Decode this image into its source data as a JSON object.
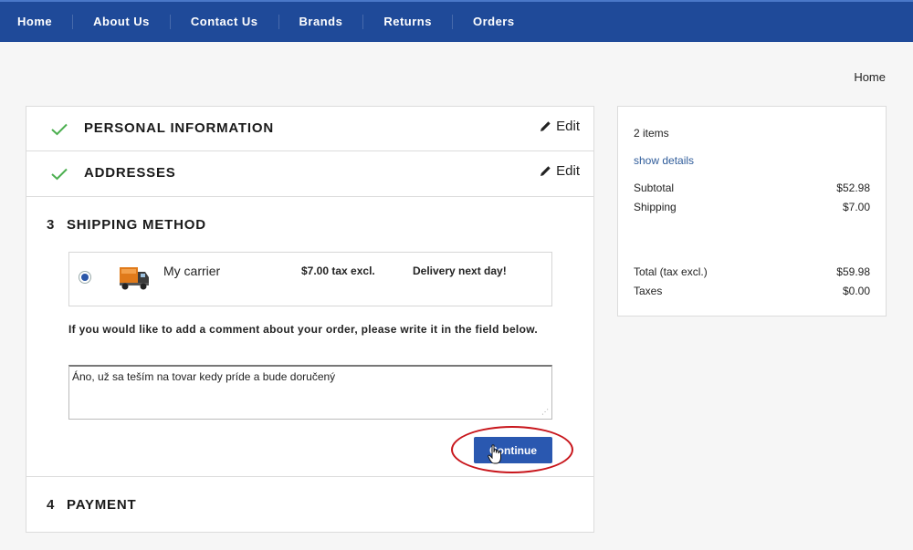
{
  "nav": {
    "items": [
      {
        "label": "Home"
      },
      {
        "label": "About Us"
      },
      {
        "label": "Contact Us"
      },
      {
        "label": "Brands"
      },
      {
        "label": "Returns"
      },
      {
        "label": "Orders"
      }
    ]
  },
  "breadcrumb": "Home",
  "steps": {
    "personal": {
      "title": "PERSONAL INFORMATION",
      "edit_label": "Edit"
    },
    "addresses": {
      "title": "ADDRESSES",
      "edit_label": "Edit"
    },
    "shipping": {
      "number": "3",
      "title": "SHIPPING METHOD",
      "carrier": {
        "name": "My carrier",
        "price": "$7.00 tax excl.",
        "delay": "Delivery next day!"
      },
      "comment_label": "If you would like to add a comment about your order, please write it in the field below.",
      "comment_value": "Áno, už sa teším na tovar kedy príde a bude doručený",
      "continue_label": "Continue"
    },
    "payment": {
      "number": "4",
      "title": "PAYMENT"
    }
  },
  "summary": {
    "items_count": "2 items",
    "show_details": "show details",
    "subtotal_label": "Subtotal",
    "subtotal_value": "$52.98",
    "shipping_label": "Shipping",
    "shipping_value": "$7.00",
    "total_label": "Total (tax excl.)",
    "total_value": "$59.98",
    "taxes_label": "Taxes",
    "taxes_value": "$0.00"
  },
  "colors": {
    "nav_bg": "#1f4a99",
    "accent": "#2a58b0",
    "check": "#4caf50",
    "highlight": "#c8161c"
  }
}
